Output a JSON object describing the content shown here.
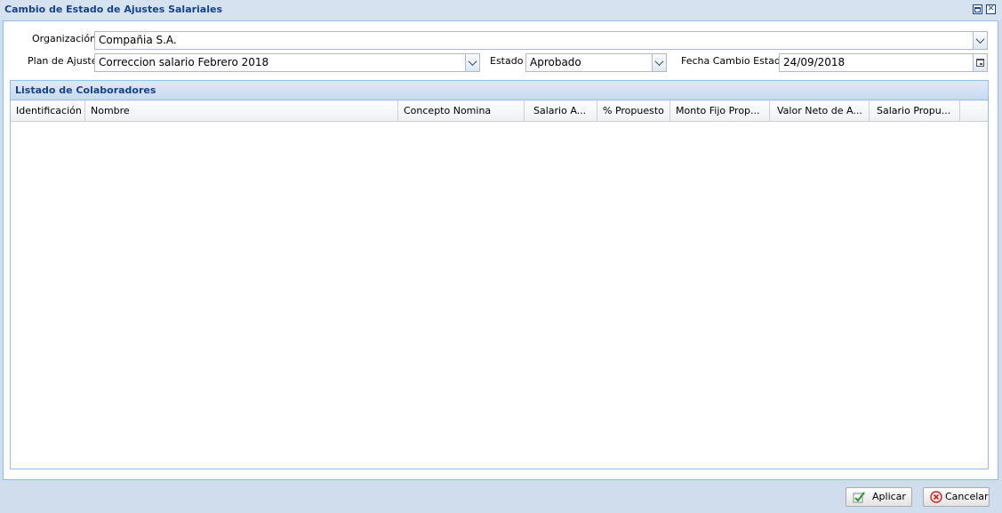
{
  "window": {
    "title": "Cambio de Estado de Ajustes Salariales",
    "maximize_icon": "maximize-icon",
    "close_icon": "close-icon"
  },
  "form": {
    "organizacion_label": "Organización",
    "organizacion_value": "Compañia S.A.",
    "plan_label": "Plan de Ajuste",
    "plan_value": "Correccion salario Febrero 2018",
    "estado_label": "Estado",
    "estado_value": "Aprobado",
    "fecha_label": "Fecha Cambio Estado",
    "fecha_value": "24/09/2018"
  },
  "grid": {
    "title": "Listado de Colaboradores",
    "columns": [
      "Identificación",
      "Nombre",
      "Concepto Nomina",
      "Salario A...",
      "% Propuesto",
      "Monto Fijo Prop...",
      "Valor Neto de A...",
      "Salario Propu..."
    ],
    "rows": []
  },
  "buttons": {
    "apply_label": "Aplicar",
    "cancel_label": "Cancelar"
  },
  "colors": {
    "title_color": "#15428b",
    "border": "#99bbe8",
    "background": "#d0dded"
  }
}
